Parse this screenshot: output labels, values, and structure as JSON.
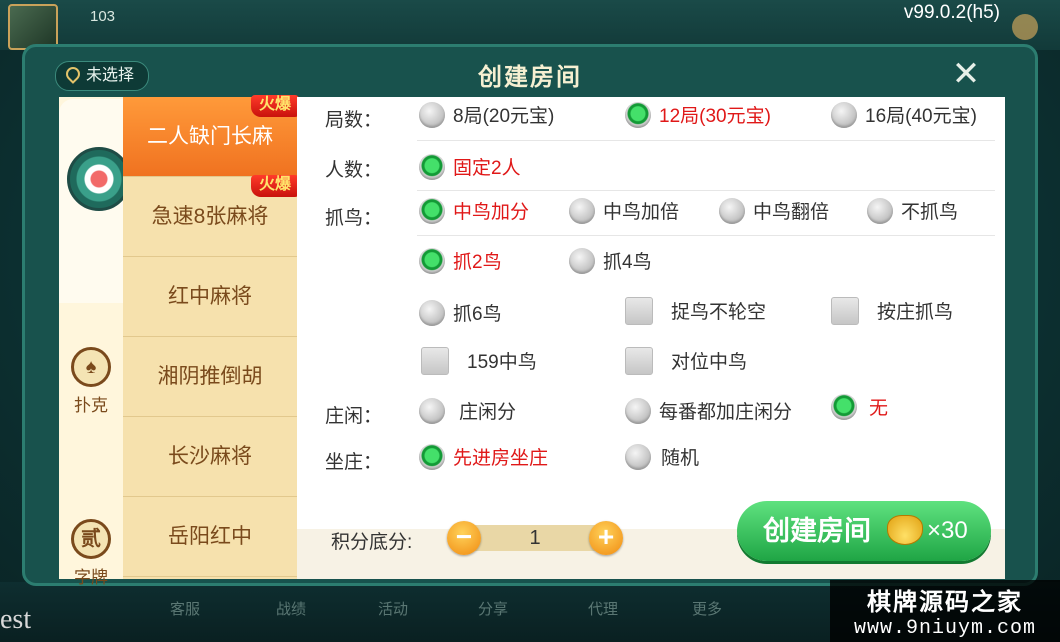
{
  "background": {
    "version": "v99.0.2(h5)",
    "user_coins": "103",
    "bottom_left_text": "est",
    "bottom_nav": [
      "客服",
      "战绩",
      "活动",
      "分享",
      "代理",
      "更多"
    ]
  },
  "watermark": {
    "line1": "棋牌源码之家",
    "line2": "www.9niuym.com"
  },
  "dialog": {
    "title": "创建房间",
    "location": "未选择",
    "close_icon": "close-icon"
  },
  "categories": [
    {
      "label": "",
      "icon": "mahjong-emblem-icon"
    },
    {
      "label": "扑克",
      "icon": "spade-icon",
      "glyph": "♠"
    },
    {
      "label": "字牌",
      "icon": "zipai-icon",
      "glyph": "贰"
    }
  ],
  "games": [
    {
      "label": "二人缺门长麻",
      "hot": "火爆",
      "active": true
    },
    {
      "label": "急速8张麻将",
      "hot": "火爆",
      "active": false
    },
    {
      "label": "红中麻将",
      "hot": "",
      "active": false
    },
    {
      "label": "湘阴推倒胡",
      "hot": "",
      "active": false
    },
    {
      "label": "长沙麻将",
      "hot": "",
      "active": false
    },
    {
      "label": "岳阳红中",
      "hot": "",
      "active": false
    }
  ],
  "options": {
    "rounds": {
      "label": "局数：",
      "choices": [
        "8局(20元宝)",
        "12局(30元宝)",
        "16局(40元宝)"
      ],
      "selected": 1
    },
    "players": {
      "label": "人数：",
      "choices": [
        "固定2人"
      ],
      "selected": 0
    },
    "bird": {
      "label": "抓鸟：",
      "choices": [
        "中鸟加分",
        "中鸟加倍",
        "中鸟翻倍",
        "不抓鸟"
      ],
      "selected": 0
    },
    "bird_count": {
      "choices": [
        "抓2鸟",
        "抓4鸟",
        "抓6鸟"
      ],
      "selected": 0
    },
    "checkboxes": [
      "捉鸟不轮空",
      "按庄抓鸟",
      "159中鸟",
      "对位中鸟"
    ],
    "dealer_idle": {
      "label": "庄闲：",
      "choices": [
        "庄闲分",
        "每番都加庄闲分",
        "无"
      ],
      "selected": 2
    },
    "sit_dealer": {
      "label": "坐庄：",
      "choices": [
        "先进房坐庄",
        "随机"
      ],
      "selected": 0
    }
  },
  "footer": {
    "score_label": "积分底分:",
    "score_value": "1",
    "minus": "−",
    "plus": "+",
    "create_label": "创建房间",
    "cost": "×30",
    "cost_icon": "gold-ingot-icon"
  },
  "colors": {
    "selected_text": "#e01818",
    "accent_green": "#1fa545",
    "tab_active": "#f07220"
  }
}
